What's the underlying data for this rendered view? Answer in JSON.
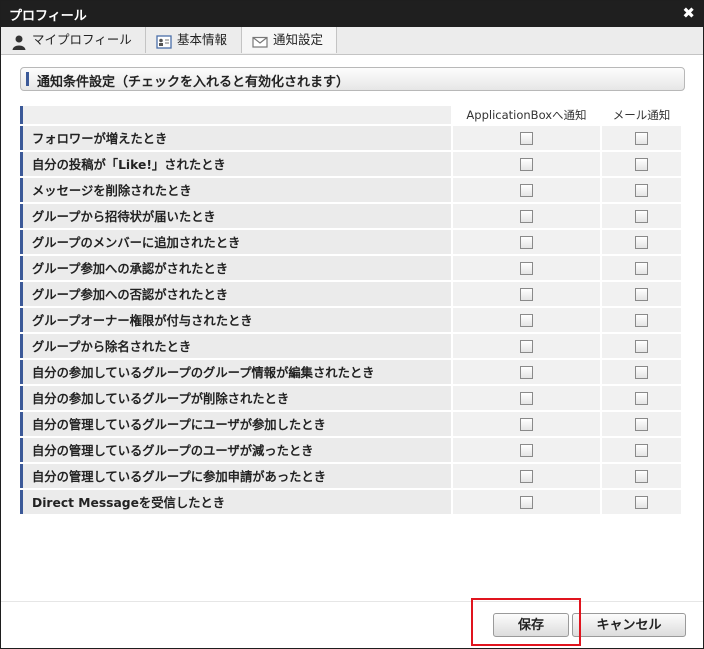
{
  "window": {
    "title": "プロフィール",
    "close_glyph": "✖"
  },
  "tabs": [
    {
      "label": "マイプロフィール",
      "icon": "person-icon",
      "active": false
    },
    {
      "label": "基本情報",
      "icon": "id-card-icon",
      "active": false
    },
    {
      "label": "通知設定",
      "icon": "envelope-icon",
      "active": true
    }
  ],
  "section": {
    "title": "通知条件設定（チェックを入れると有効化されます）"
  },
  "columns": {
    "app": "ApplicationBoxへ通知",
    "mail": "メール通知"
  },
  "rows": [
    {
      "label": "フォロワーが増えたとき",
      "app": false,
      "mail": false
    },
    {
      "label": "自分の投稿が「Like!」されたとき",
      "app": false,
      "mail": false
    },
    {
      "label": "メッセージを削除されたとき",
      "app": false,
      "mail": false
    },
    {
      "label": "グループから招待状が届いたとき",
      "app": false,
      "mail": false
    },
    {
      "label": "グループのメンバーに追加されたとき",
      "app": false,
      "mail": false
    },
    {
      "label": "グループ参加への承認がされたとき",
      "app": false,
      "mail": false
    },
    {
      "label": "グループ参加への否認がされたとき",
      "app": false,
      "mail": false
    },
    {
      "label": "グループオーナー権限が付与されたとき",
      "app": false,
      "mail": false
    },
    {
      "label": "グループから除名されたとき",
      "app": false,
      "mail": false
    },
    {
      "label": "自分の参加しているグループのグループ情報が編集されたとき",
      "app": false,
      "mail": false
    },
    {
      "label": "自分の参加しているグループが削除されたとき",
      "app": false,
      "mail": false
    },
    {
      "label": "自分の管理しているグループにユーザが参加したとき",
      "app": false,
      "mail": false
    },
    {
      "label": "自分の管理しているグループのユーザが減ったとき",
      "app": false,
      "mail": false
    },
    {
      "label": "自分の管理しているグループに参加申請があったとき",
      "app": false,
      "mail": false
    },
    {
      "label": "Direct Messageを受信したとき",
      "app": false,
      "mail": false
    }
  ],
  "buttons": {
    "save": "保存",
    "cancel": "キャンセル"
  },
  "colors": {
    "titlebar": "#1f1f1f",
    "accent": "#3b5998",
    "highlight": "#e0141e"
  }
}
